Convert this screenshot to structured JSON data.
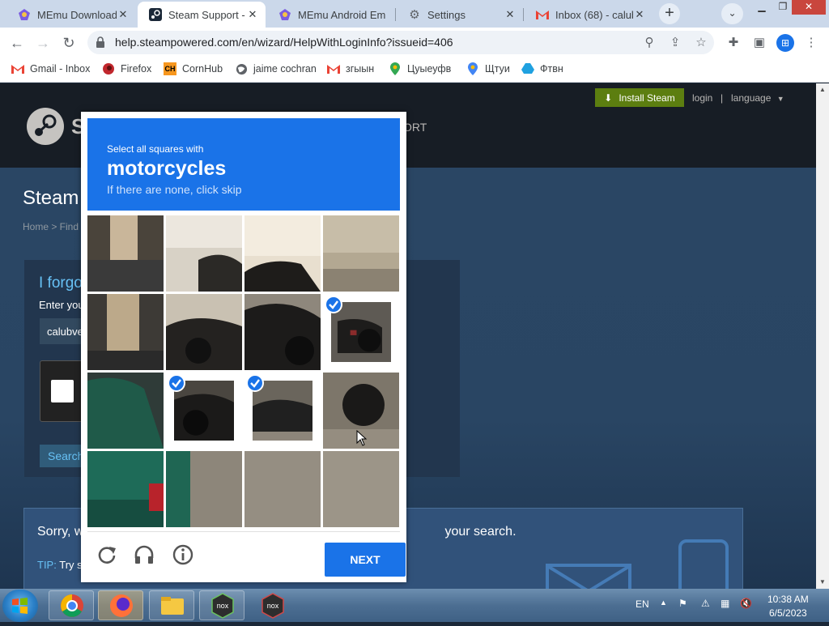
{
  "browser": {
    "tabs": [
      {
        "label": "MEmu Download",
        "active": false,
        "icon": "memu-icon"
      },
      {
        "label": "Steam Support - I",
        "active": true,
        "icon": "steam-icon"
      },
      {
        "label": "MEmu Android Em",
        "active": false,
        "icon": "memu-icon"
      },
      {
        "label": "Settings",
        "active": false,
        "icon": "gear-icon"
      },
      {
        "label": "Inbox (68) - calub",
        "active": false,
        "icon": "gmail-icon"
      }
    ],
    "new_tab": "+",
    "url": "help.steampowered.com/en/wizard/HelpWithLoginInfo?issueid=406",
    "bookmarks": [
      {
        "label": "Gmail - Inbox",
        "icon": "gmail-icon"
      },
      {
        "label": "Firefox",
        "icon": "firefox-icon"
      },
      {
        "label": "CornHub",
        "icon": "ch-icon"
      },
      {
        "label": "jaime cochran",
        "icon": "globe-icon"
      },
      {
        "label": "згыын",
        "icon": "gmail-icon"
      },
      {
        "label": "Цуыеуфв",
        "icon": "maps-icon"
      },
      {
        "label": "Щтуи",
        "icon": "maps-icon"
      },
      {
        "label": "Фтвн",
        "icon": "drive-icon"
      }
    ]
  },
  "steam": {
    "install_label": "Install Steam",
    "login_label": "login",
    "separator": "|",
    "language_label": "language",
    "logo_letter": "S",
    "nav_support": "ORT",
    "title": "Steam",
    "breadcrumb": "Home > Find",
    "forgot_title": "I forgo",
    "enter_label": "Enter you",
    "account_value": "calubve",
    "search_label": "Search",
    "sorry_text_start": "Sorry, w",
    "sorry_text_end": "your search.",
    "tip_label": "TIP:",
    "tip_text": "Try s"
  },
  "captcha": {
    "instruction": "Select all squares with",
    "target": "motorcycles",
    "skip_text": "If there are none, click skip",
    "next_label": "NEXT",
    "tiles_selected": [
      7,
      9,
      10
    ],
    "colors": {
      "accent": "#1a73e8"
    }
  },
  "taskbar": {
    "language": "EN",
    "time": "10:38 AM",
    "date": "6/5/2023"
  }
}
